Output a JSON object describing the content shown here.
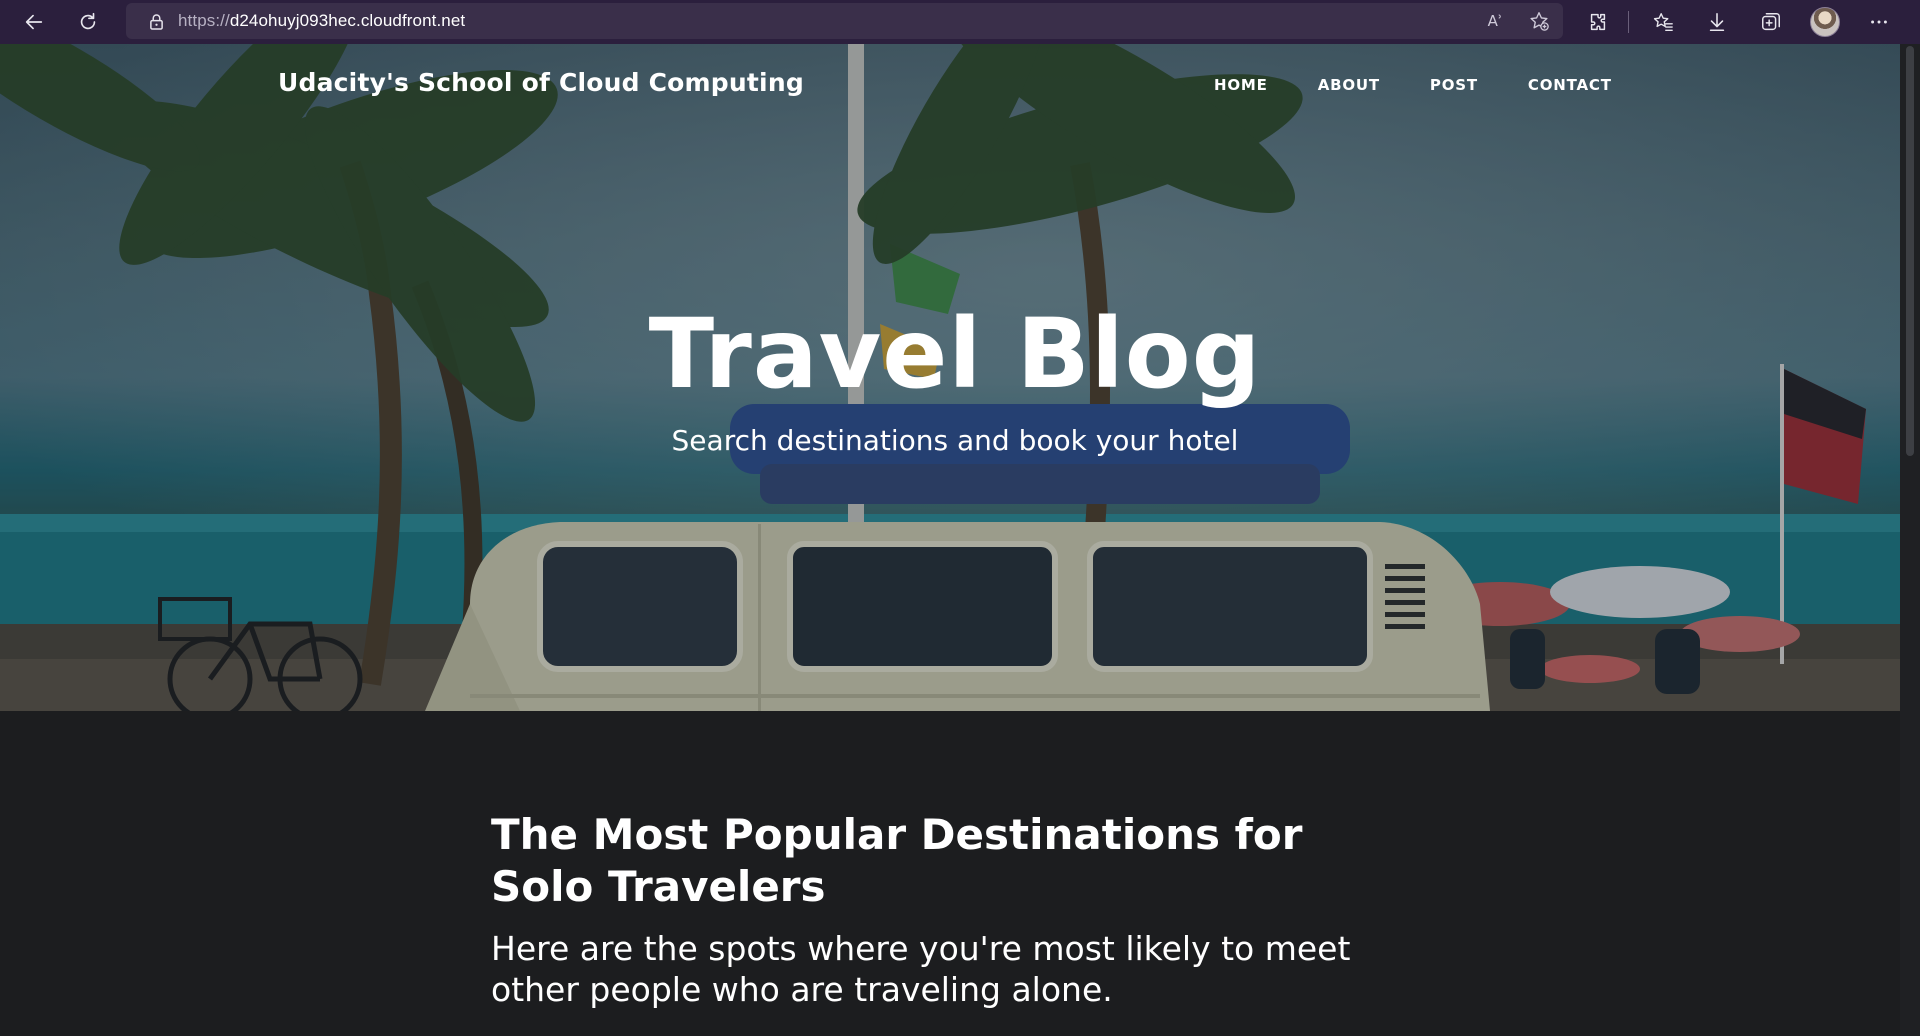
{
  "browser": {
    "url_scheme": "https://",
    "url_host": "d24ohuyj093hec.cloudfront.net",
    "read_aloud_label": "Aʾ"
  },
  "site": {
    "brand": "Udacity's School of Cloud Computing",
    "nav": [
      "HOME",
      "ABOUT",
      "POST",
      "CONTACT"
    ]
  },
  "hero": {
    "title": "Travel Blog",
    "subtitle": "Search destinations and book your hotel"
  },
  "post": {
    "title": "The Most Popular Destinations for Solo Travelers",
    "subtitle": "Here are the spots where you're most likely to meet other people who are traveling alone."
  }
}
